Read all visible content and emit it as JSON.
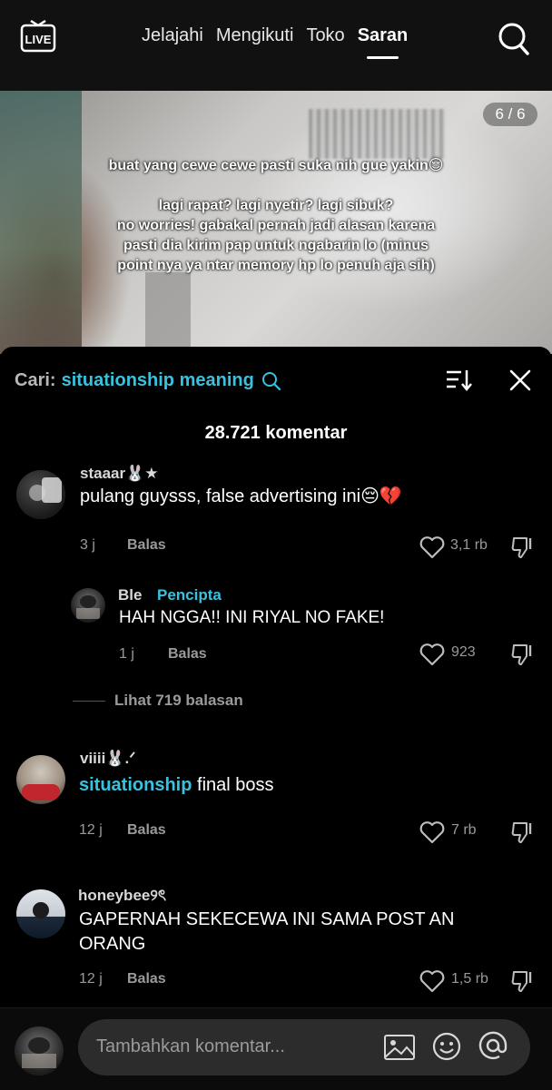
{
  "nav": {
    "live_label": "LIVE",
    "tabs": [
      {
        "label": "Jelajahi",
        "active": false
      },
      {
        "label": "Mengikuti",
        "active": false
      },
      {
        "label": "Toko",
        "active": false
      },
      {
        "label": "Saran",
        "active": true
      }
    ],
    "search_icon": "search-icon"
  },
  "post": {
    "page_counter": "6 / 6",
    "caption_lines": [
      "buat yang cewe cewe pasti suka nih gue yakin😌",
      "",
      "lagi rapat? lagi nyetir? lagi  sibuk?",
      "no worries! gabakal pernah jadi alasan karena",
      "pasti dia kirim pap untuk ngabarin lo (minus",
      "point nya ya ntar memory hp lo penuh aja sih)"
    ]
  },
  "comments_panel": {
    "search_prefix": "Cari:",
    "search_term": "situationship meaning",
    "count_label": "28.721 komentar",
    "reply_label": "Balas",
    "comments": [
      {
        "username": "staaar🐰★",
        "text": "pulang guysss, false advertising ini😔💔",
        "time": "3 j",
        "likes": "3,1 rb"
      },
      {
        "username": "Ble",
        "creator_tag": "Pencipta",
        "text": "HAH NGGA!! INI RIYAL NO FAKE!",
        "time": "1 j",
        "likes": "923"
      },
      {
        "username": "viiii🐰.ᐟ",
        "mention": "situationship",
        "text": " final boss",
        "time": "12 j",
        "likes": "7 rb"
      },
      {
        "username": "honeybee୨ৎ",
        "text_line1": "GAPERNAH SEKECEWA INI SAMA POST AN",
        "text_line2": "ORANG",
        "time": "12 j",
        "likes": "1,5 rb"
      }
    ],
    "view_replies": "Lihat 719 balasan"
  },
  "composer": {
    "placeholder": "Tambahkan komentar..."
  },
  "colors": {
    "accent": "#37c3e0",
    "background": "#000000",
    "muted": "#9a9a9a",
    "input_bg": "#2c2c2c"
  }
}
